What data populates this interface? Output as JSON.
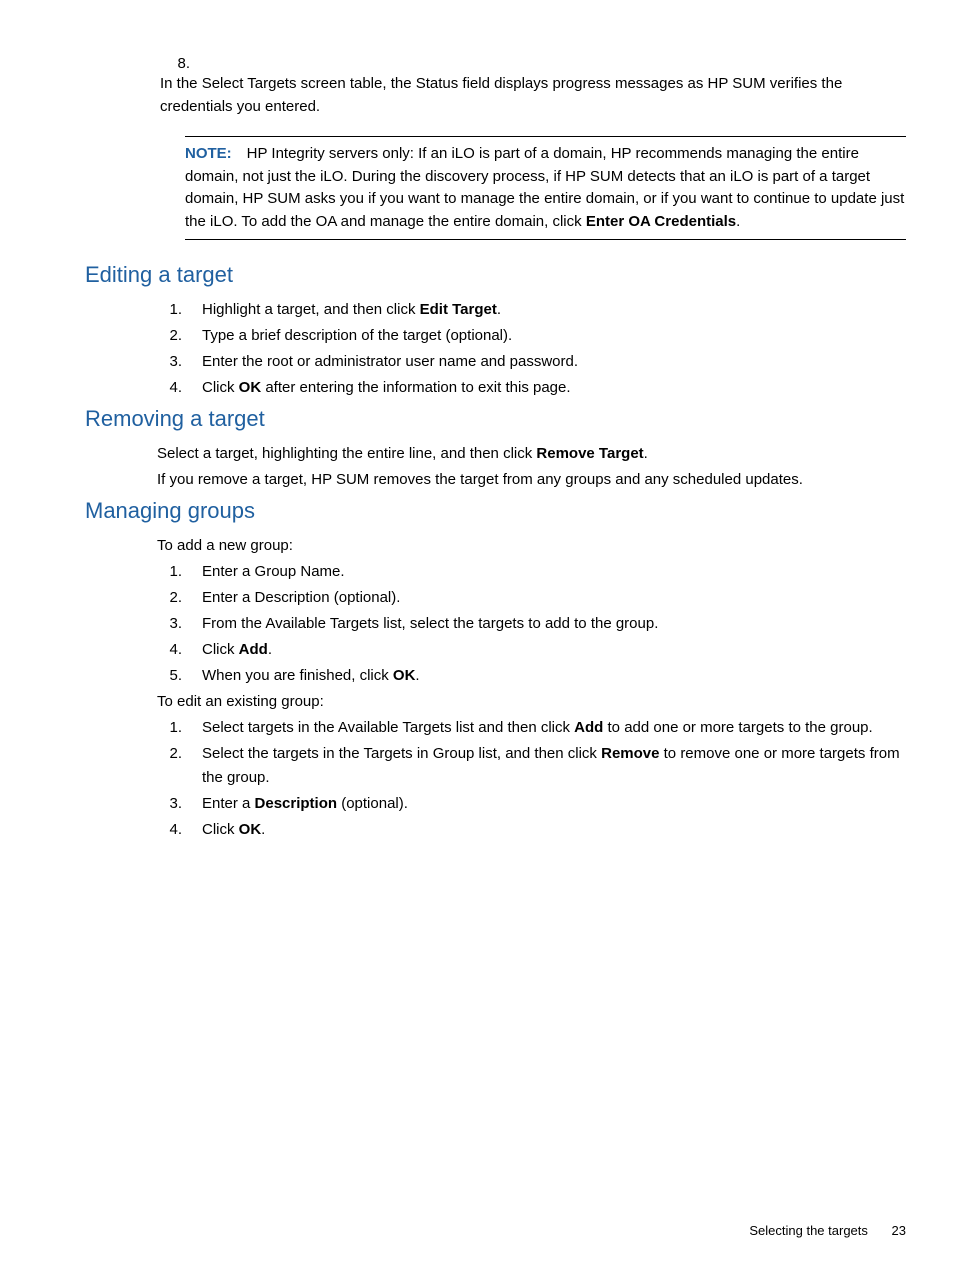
{
  "step8": {
    "num": "8.",
    "text": "In the Select Targets screen table, the Status field displays progress messages as HP SUM verifies the credentials you entered."
  },
  "note": {
    "label": "NOTE:",
    "text_before": "HP Integrity servers only: If an iLO is part of a domain, HP recommends managing the entire domain, not just the iLO. During the discovery process, if HP SUM detects that an iLO is part of a target domain, HP SUM asks you if you want to manage the entire domain, or if you want to continue to update just the iLO. To add the OA and manage the entire domain, click ",
    "bold1": "Enter OA Credentials",
    "text_after": "."
  },
  "sections": {
    "editing": {
      "heading": "Editing a target",
      "steps": [
        {
          "pre": "Highlight a target, and then click ",
          "bold": "Edit Target",
          "post": "."
        },
        {
          "pre": "Type a brief description of the target (optional).",
          "bold": "",
          "post": ""
        },
        {
          "pre": "Enter the root or administrator user name and password.",
          "bold": "",
          "post": ""
        },
        {
          "pre": "Click ",
          "bold": "OK",
          "post": " after entering the information to exit this page."
        }
      ]
    },
    "removing": {
      "heading": "Removing a target",
      "para1_pre": "Select a target, highlighting the entire line, and then click ",
      "para1_bold": "Remove Target",
      "para1_post": ".",
      "para2": "If you remove a target, HP SUM removes the target from any groups and any scheduled updates."
    },
    "managing": {
      "heading": "Managing groups",
      "intro1": "To add a new group:",
      "steps1": [
        {
          "pre": "Enter a Group Name.",
          "bold": "",
          "post": ""
        },
        {
          "pre": "Enter a Description (optional).",
          "bold": "",
          "post": ""
        },
        {
          "pre": "From the Available Targets list, select the targets to add to the group.",
          "bold": "",
          "post": ""
        },
        {
          "pre": "Click ",
          "bold": "Add",
          "post": "."
        },
        {
          "pre": "When you are finished, click ",
          "bold": "OK",
          "post": "."
        }
      ],
      "intro2": "To edit an existing group:",
      "steps2": [
        {
          "pre": "Select targets in the Available Targets list and then click ",
          "bold": "Add",
          "post": " to add one or more targets to the group."
        },
        {
          "pre": "Select the targets in the Targets in Group list, and then click ",
          "bold": "Remove",
          "post": " to remove one or more targets from the group."
        },
        {
          "pre": "Enter a ",
          "bold": "Description",
          "post": " (optional)."
        },
        {
          "pre": "Click ",
          "bold": "OK",
          "post": "."
        }
      ]
    }
  },
  "footer": {
    "text": "Selecting the targets",
    "page": "23"
  }
}
